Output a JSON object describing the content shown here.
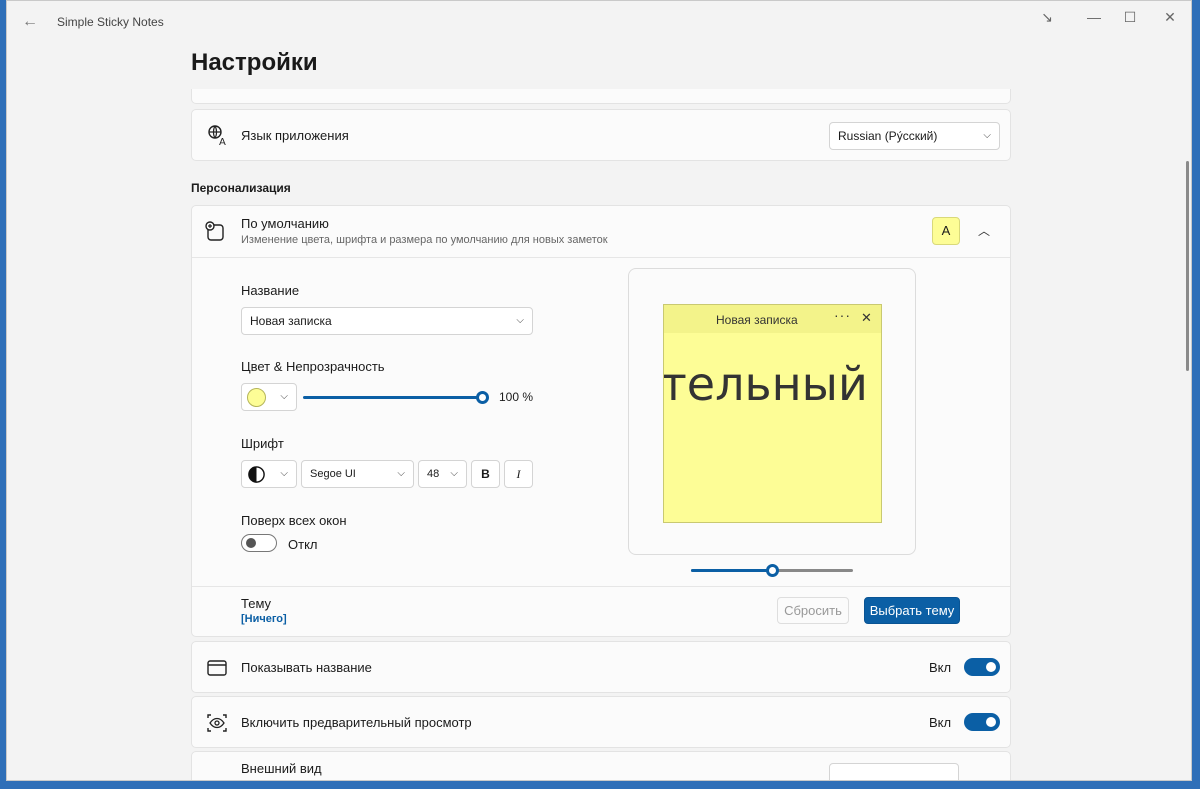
{
  "window": {
    "title": "Simple Sticky Notes",
    "back_icon": "back-arrow-icon"
  },
  "page_title": "Настройки",
  "language": {
    "label": "Язык приложения",
    "value": "Russian (Ру́сский)"
  },
  "section_personalization": "Персонализация",
  "defaults": {
    "title": "По умолчанию",
    "subtitle": "Изменение цвета, шрифта и размера по умолчанию для новых заметок",
    "preview_letter": "A",
    "name_label": "Название",
    "name_value": "Новая записка",
    "color_label": "Цвет & Непрозрачность",
    "opacity": "100 %",
    "opacity_value": 1.0,
    "font_label": "Шрифт",
    "font_family": "Segoe UI",
    "font_size": "48",
    "bold": "B",
    "italic": "I",
    "topmost_label": "Поверх всех окон",
    "topmost_state": "Откл",
    "note_title": "Новая записка",
    "note_text": "тельный",
    "note_color": "#fdfd96",
    "zoom_value": 0.5
  },
  "theme": {
    "label": "Тему",
    "value": "[Ничего]",
    "reset": "Сбросить",
    "choose": "Выбрать тему"
  },
  "show_title": {
    "label": "Показывать название",
    "state": "Вкл"
  },
  "preview": {
    "label": "Включить предварительный просмотр",
    "state": "Вкл"
  },
  "appearance": {
    "label": "Внешний вид"
  },
  "colors": {
    "accent": "#0b5fa5"
  }
}
